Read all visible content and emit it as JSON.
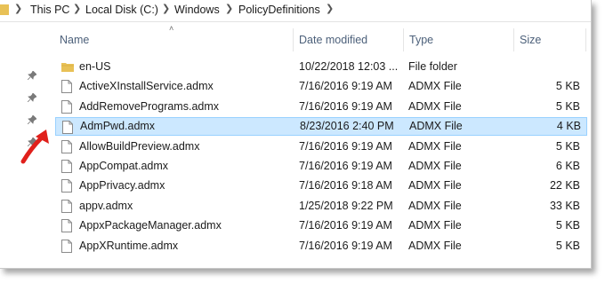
{
  "breadcrumb": [
    "This PC",
    "Local Disk (C:)",
    "Windows",
    "PolicyDefinitions"
  ],
  "columns": {
    "name": "Name",
    "date": "Date modified",
    "type": "Type",
    "size": "Size"
  },
  "files": [
    {
      "name": "en-US",
      "date": "10/22/2018 12:03 ...",
      "type": "File folder",
      "size": "",
      "icon": "folder-icon"
    },
    {
      "name": "ActiveXInstallService.admx",
      "date": "7/16/2016 9:19 AM",
      "type": "ADMX File",
      "size": "5 KB",
      "icon": "file-icon"
    },
    {
      "name": "AddRemovePrograms.admx",
      "date": "7/16/2016 9:19 AM",
      "type": "ADMX File",
      "size": "5 KB",
      "icon": "file-icon"
    },
    {
      "name": "AdmPwd.admx",
      "date": "8/23/2016 2:40 PM",
      "type": "ADMX File",
      "size": "4 KB",
      "icon": "file-icon",
      "selected": true
    },
    {
      "name": "AllowBuildPreview.admx",
      "date": "7/16/2016 9:19 AM",
      "type": "ADMX File",
      "size": "5 KB",
      "icon": "file-icon"
    },
    {
      "name": "AppCompat.admx",
      "date": "7/16/2016 9:19 AM",
      "type": "ADMX File",
      "size": "6 KB",
      "icon": "file-icon"
    },
    {
      "name": "AppPrivacy.admx",
      "date": "7/16/2016 9:18 AM",
      "type": "ADMX File",
      "size": "22 KB",
      "icon": "file-icon"
    },
    {
      "name": "appv.admx",
      "date": "1/25/2018 9:22 PM",
      "type": "ADMX File",
      "size": "33 KB",
      "icon": "file-icon"
    },
    {
      "name": "AppxPackageManager.admx",
      "date": "7/16/2016 9:19 AM",
      "type": "ADMX File",
      "size": "5 KB",
      "icon": "file-icon"
    },
    {
      "name": "AppXRuntime.admx",
      "date": "7/16/2016 9:19 AM",
      "type": "ADMX File",
      "size": "5 KB",
      "icon": "file-icon"
    }
  ],
  "colors": {
    "selection_bg": "#cce8ff",
    "selection_border": "#99d1ff",
    "header_text": "#4c607a",
    "folder": "#e8c156",
    "arrow": "#e0201b"
  }
}
